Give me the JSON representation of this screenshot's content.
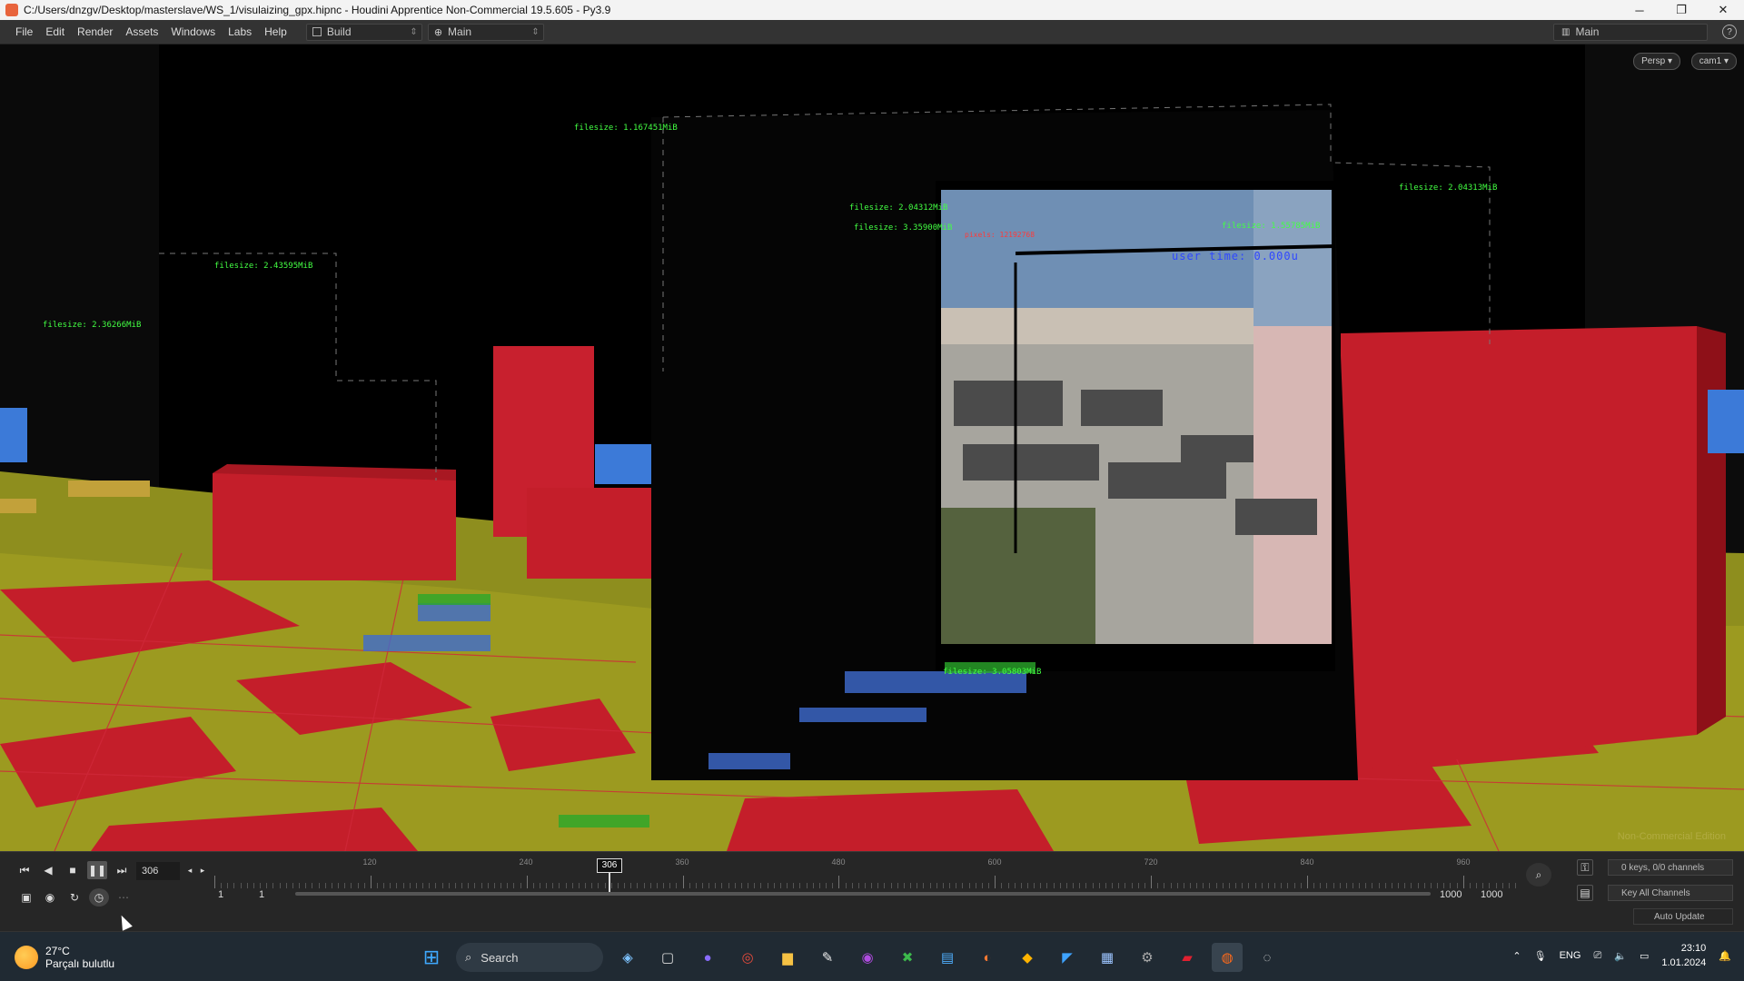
{
  "window": {
    "title": "C:/Users/dnzgv/Desktop/masterslave/WS_1/visulaizing_gpx.hipnc - Houdini Apprentice Non-Commercial 19.5.605 - Py3.9",
    "minimize": "─",
    "maximize": "❐",
    "close": "✕"
  },
  "menubar": {
    "items": [
      "File",
      "Edit",
      "Render",
      "Assets",
      "Windows",
      "Labs",
      "Help"
    ],
    "desktop_build": "Build",
    "desktop_main": "Main",
    "right_desktop": "Main",
    "help": "?"
  },
  "viewport": {
    "persp_label": "Persp ▾",
    "cam_label": "cam1 ▾",
    "watermark": "Non-Commercial Edition",
    "overlay_texts": [
      {
        "kind": "file",
        "text": "filesize: 1.167451MiB"
      },
      {
        "kind": "file",
        "text": "filesize: 2.04312MiB"
      },
      {
        "kind": "file",
        "text": "filesize: 3.35900MiB"
      },
      {
        "kind": "file",
        "text": "filesize: 2.43595MiB"
      },
      {
        "kind": "file",
        "text": "filesize: 2.36266MiB"
      },
      {
        "kind": "file",
        "text": "filesize: 1.55785MiB"
      },
      {
        "kind": "file",
        "text": "filesize: 3.05803MiB"
      },
      {
        "kind": "file",
        "text": "filesize: 2.04313MiB"
      },
      {
        "kind": "user",
        "text": "user time: 0.000u"
      },
      {
        "kind": "pixel",
        "text": "pixels: 12192768"
      }
    ]
  },
  "timeline": {
    "current_frame": "306",
    "ruler_labels": [
      "120",
      "240",
      "360",
      "480",
      "600",
      "720",
      "840",
      "960"
    ],
    "start_frame": "1",
    "start_frame2": "1",
    "end_frame": "1000",
    "end_frame2": "1000",
    "keys_info": "0 keys, 0/0 channels",
    "key_all": "Key All Channels",
    "auto_update": "Auto Update"
  },
  "taskbar": {
    "temperature": "27°C",
    "weather_desc": "Parçalı bulutlu",
    "search_label": "Search",
    "lang": "ENG",
    "time": "23:10",
    "date": "1.01.2024"
  }
}
